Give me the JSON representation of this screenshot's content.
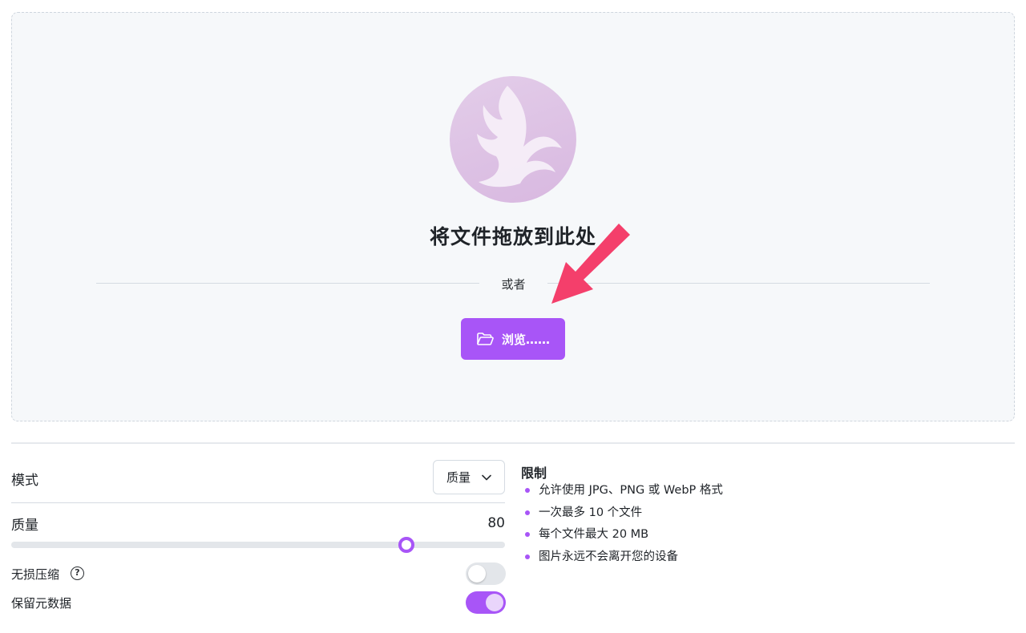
{
  "dropzone": {
    "title": "将文件拖放到此处",
    "divider_text": "或者",
    "browse_label": "浏览……",
    "logo_icon": "phoenix-logo-icon",
    "button_icon": "folder-open-icon",
    "annotation": "red-arrow-pointer"
  },
  "settings": {
    "mode_label": "模式",
    "mode_selected": "质量",
    "quality_label": "质量",
    "quality_value": "80",
    "quality_fraction": 0.8,
    "lossless_label": "无损压缩",
    "lossless_help_icon": "?",
    "lossless_on": false,
    "keep_metadata_label": "保留元数据",
    "keep_metadata_on": true
  },
  "limits": {
    "title": "限制",
    "items": [
      "允许使用 JPG、PNG 或 WebP 格式",
      "一次最多 10 个文件",
      "每个文件最大 20 MB",
      "图片永远不会离开您的设备"
    ]
  },
  "colors": {
    "accent": "#a855f7",
    "arrow": "#f43f6b",
    "logo_bg": "#dcc1e4"
  }
}
